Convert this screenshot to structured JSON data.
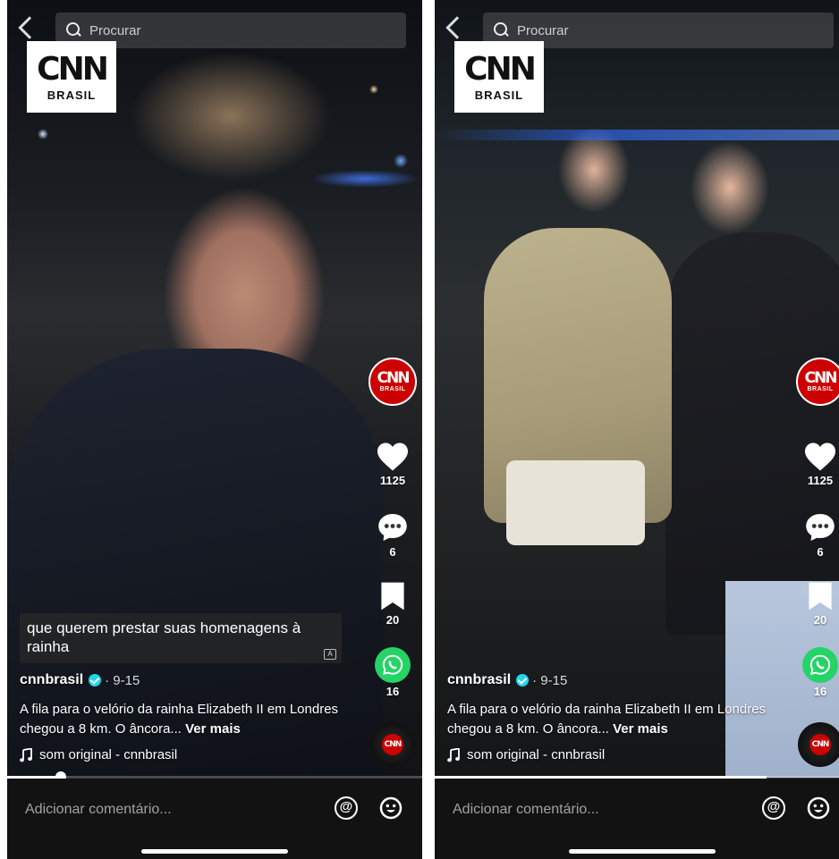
{
  "colors": {
    "cnn_red": "#cc0000",
    "verified_blue": "#20d5ec",
    "whatsapp_green": "#25d366"
  },
  "screens": [
    {
      "search": {
        "placeholder": "Procurar"
      },
      "logo": {
        "mark": "CNN",
        "sub": "BRASIL"
      },
      "avatar": {
        "mark": "CNN",
        "sub": "BRASIL"
      },
      "actions": {
        "likes": "1125",
        "comments": "6",
        "saves": "20",
        "shares": "16"
      },
      "subtitle": "que querem prestar suas homenagens à rainha",
      "username": "cnnbrasil",
      "date": "· 9-15",
      "description": "A fila para o velório da rainha Elizabeth II em Londres chegou a 8 km. O âncora...",
      "see_more": "Ver mais",
      "sound": "som original - cnnbrasil",
      "progress": 0.13,
      "comment_placeholder": "Adicionar comentário..."
    },
    {
      "search": {
        "placeholder": "Procurar"
      },
      "logo": {
        "mark": "CNN",
        "sub": "BRASIL"
      },
      "avatar": {
        "mark": "CNN",
        "sub": "BRASIL"
      },
      "actions": {
        "likes": "1125",
        "comments": "6",
        "saves": "20",
        "shares": "16"
      },
      "username": "cnnbrasil",
      "date": "· 9-15",
      "description": "A fila para o velório da rainha Elizabeth II em Londres chegou a 8 km. O âncora...",
      "see_more": "Ver mais",
      "sound": "som original - cnnbrasil",
      "progress": 0.8,
      "comment_placeholder": "Adicionar comentário..."
    }
  ]
}
